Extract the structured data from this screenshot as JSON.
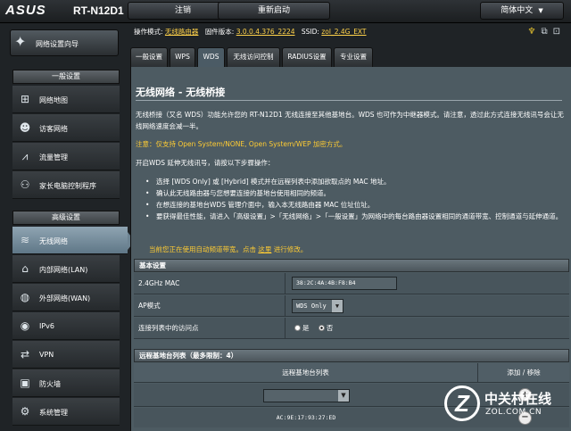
{
  "header": {
    "brand": "ASUS",
    "model": "RT-N12D1",
    "logout_label": "注销",
    "reboot_label": "重新启动",
    "language_label": "简体中文"
  },
  "status": {
    "mode_label": "操作模式:",
    "mode_value": "无线路由器",
    "firmware_label": "固件版本:",
    "firmware_value": "3.0.0.4.376_2224",
    "ssid_label": "SSID:",
    "ssid_value": "zol_2.4G_EXT"
  },
  "sidebar": {
    "qis_label": "网络设置向导",
    "general_header": "一般设置",
    "general_items": [
      {
        "label": "网络地图",
        "icon": "network-map-icon"
      },
      {
        "label": "访客网络",
        "icon": "guest-network-icon"
      },
      {
        "label": "流量管理",
        "icon": "traffic-manager-icon"
      },
      {
        "label": "家长电脑控制程序",
        "icon": "parental-control-icon"
      }
    ],
    "advanced_header": "高级设置",
    "advanced_items": [
      {
        "label": "无线网络",
        "icon": "wireless-icon",
        "active": true
      },
      {
        "label": "内部网络(LAN)",
        "icon": "lan-icon"
      },
      {
        "label": "外部网络(WAN)",
        "icon": "wan-icon"
      },
      {
        "label": "IPv6",
        "icon": "ipv6-icon"
      },
      {
        "label": "VPN",
        "icon": "vpn-icon"
      },
      {
        "label": "防火墙",
        "icon": "firewall-icon"
      },
      {
        "label": "系统管理",
        "icon": "administration-icon"
      }
    ]
  },
  "tabs": [
    {
      "label": "一般设置"
    },
    {
      "label": "WPS"
    },
    {
      "label": "WDS",
      "active": true
    },
    {
      "label": "无线访问控制"
    },
    {
      "label": "RADIUS设置"
    },
    {
      "label": "专业设置"
    }
  ],
  "main": {
    "title": "无线网络 - 无线桥接",
    "intro": "无线桥接（又名 WDS）功能允许您的 RT-N12D1 无线连接至其他基地台。WDS 也可作为中继器模式。请注意，透过此方式连接无线讯号会让无线网络速度会减一半。",
    "note": "注意：仅支持 Open System/NONE, Open System/WEP 加密方式。",
    "steps_intro": "开启WDS 延伸无线讯号，请按以下步骤操作：",
    "steps": [
      "选择 [WDS Only] 或 [Hybrid] 模式并在远程列表中添加欲取点的 MAC 地址。",
      "确认此无线路由器与您想要连接的基地台使用相同的频道。",
      "在想连接的基地台WDS 管理介面中，输入本无线路由器 MAC 位址位址。",
      "要获得最佳性能，请进入「高级设置」>「无线网络」>「一般设置」为网络中的每台路由器设置相同的通道带宽、控制通道与延伸通道。"
    ],
    "auto_note_prefix": "当前您正在使用自动频道带宽。点击 ",
    "auto_note_link": "这里",
    "auto_note_suffix": " 进行修改。"
  },
  "basic": {
    "header": "基本设置",
    "mac_label": "2.4GHz MAC",
    "mac_value": "38:2C:4A:4B:F8:B4",
    "ap_mode_label": "AP模式",
    "ap_mode_value": "WDS Only",
    "connect_label": "连接列表中的访问点",
    "yes_label": "是",
    "no_label": "否",
    "connect_value": "no"
  },
  "remote": {
    "header": "远程基地台列表（最多限制：4）",
    "col_list": "远程基地台列表",
    "col_action": "添加 / 移除",
    "entries": [
      "AC:9E:17:93:27:ED"
    ]
  },
  "watermark": {
    "zh": "中关村在线",
    "en": "ZOL.COM.CN"
  }
}
